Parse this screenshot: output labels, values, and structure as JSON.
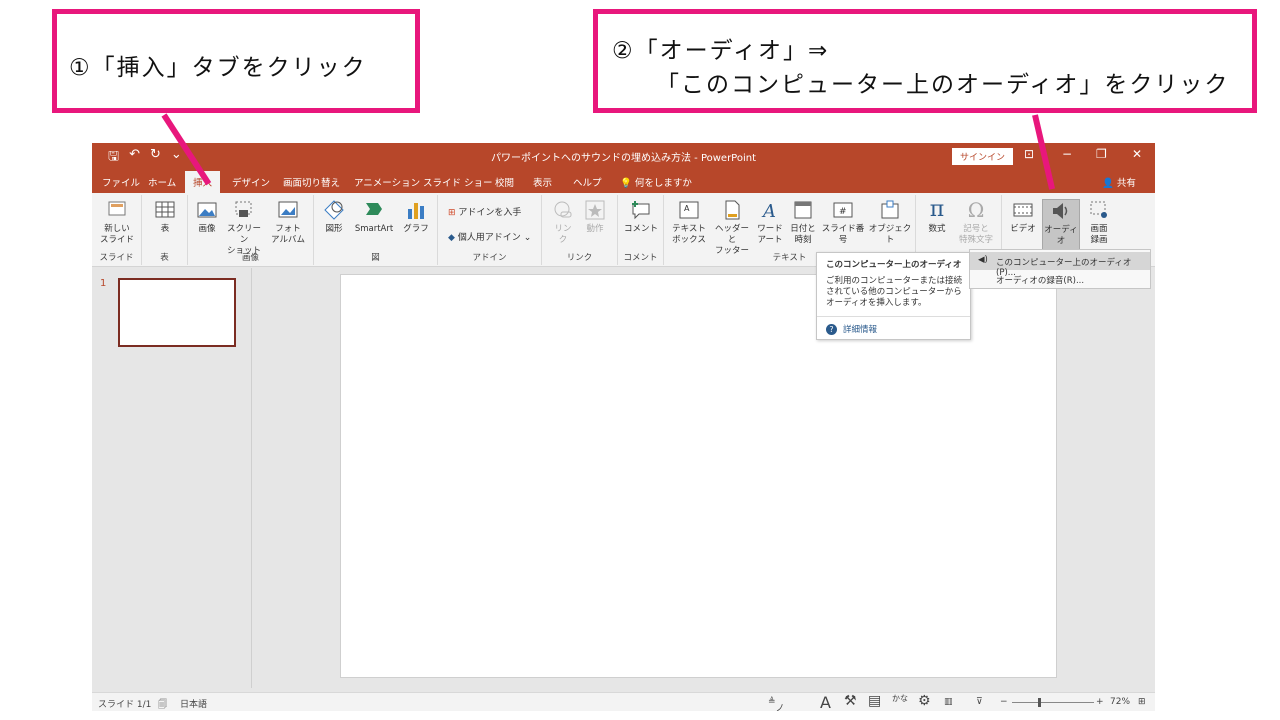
{
  "callouts": {
    "step1": "①「挿入」タブをクリック",
    "step2_line1": "②「オーディオ」⇒",
    "step2_line2": "「このコンピューター上のオーディオ」をクリック"
  },
  "titlebar": {
    "title": "パワーポイントへのサウンドの埋め込み方法 - PowerPoint",
    "signin": "サインイン"
  },
  "tabs": [
    "ファイル",
    "ホーム",
    "挿入",
    "デザイン",
    "画面切り替え",
    "アニメーション",
    "スライド ショー",
    "校閲",
    "表示",
    "ヘルプ",
    "何をしますか"
  ],
  "share": "共有",
  "ribbon": {
    "new_slide": [
      "新しい",
      "スライド"
    ],
    "table": "表",
    "image": "画像",
    "screenshot": [
      "スクリーン",
      "ショット"
    ],
    "photo_album": [
      "フォト",
      "アルバム"
    ],
    "shapes": "図形",
    "smartart": "SmartArt",
    "graph": "グラフ",
    "get_addins": "アドインを入手",
    "my_addins": "個人用アドイン",
    "link": [
      "リン",
      "ク"
    ],
    "action": "動作",
    "comment": "コメント",
    "textbox": [
      "テキスト",
      "ボックス"
    ],
    "header_footer": [
      "ヘッダーと",
      "フッター"
    ],
    "wordart": [
      "ワード",
      "アート"
    ],
    "datetime": [
      "日付と",
      "時刻"
    ],
    "slide_number": "スライド番号",
    "object": "オブジェクト",
    "equation": "数式",
    "symbol": [
      "記号と",
      "特殊文字"
    ],
    "video": "ビデオ",
    "audio": "オーディオ",
    "screen_record": [
      "画面",
      "録画"
    ],
    "groups": {
      "slides": "スライド",
      "tables": "表",
      "images": "画像",
      "illustrations": "図",
      "addins": "アドイン",
      "links": "リンク",
      "comments": "コメント",
      "text": "テキスト"
    }
  },
  "thumb_number": "1",
  "tooltip": {
    "title": "このコンピューター上のオーディオ",
    "body": "ご利用のコンピューターまたは接続されている他のコンピューターからオーディオを挿入します。",
    "more": "詳細情報"
  },
  "dropdown": {
    "item1": "このコンピューター上のオーディオ(P)...",
    "item2": "オーディオの録音(R)..."
  },
  "statusbar": {
    "slide_pos": "スライド 1/1",
    "lang": "日本語",
    "notes": "ノート",
    "zoom": "72%"
  },
  "colors": {
    "accent": "#e8177c",
    "ppt_red": "#b7472a"
  }
}
